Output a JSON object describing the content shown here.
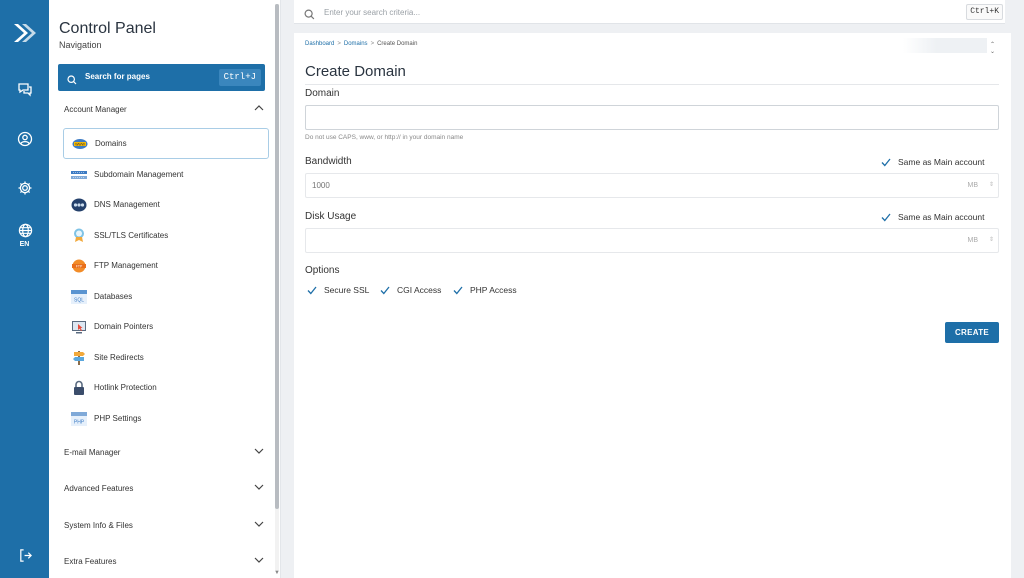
{
  "rail": {
    "language": "EN",
    "brand_color": "#1e6fa8"
  },
  "sidebar": {
    "title": "Control Panel",
    "subtitle": "Navigation",
    "search_label": "Search for pages",
    "search_shortcut": "Ctrl+J",
    "account_manager": {
      "label": "Account Manager",
      "items": [
        {
          "label": "Domains",
          "icon": "domains-icon",
          "active": true
        },
        {
          "label": "Subdomain Management",
          "icon": "subdomain-icon"
        },
        {
          "label": "DNS Management",
          "icon": "dns-icon"
        },
        {
          "label": "SSL/TLS Certificates",
          "icon": "ssl-certificate-icon"
        },
        {
          "label": "FTP Management",
          "icon": "ftp-icon"
        },
        {
          "label": "Databases",
          "icon": "sql-database-icon"
        },
        {
          "label": "Domain Pointers",
          "icon": "domain-pointer-icon"
        },
        {
          "label": "Site Redirects",
          "icon": "signpost-icon"
        },
        {
          "label": "Hotlink Protection",
          "icon": "padlock-icon"
        },
        {
          "label": "PHP Settings",
          "icon": "php-icon"
        }
      ]
    },
    "sections": [
      {
        "label": "E-mail Manager"
      },
      {
        "label": "Advanced Features"
      },
      {
        "label": "System Info & Files"
      },
      {
        "label": "Extra Features"
      }
    ]
  },
  "topbar": {
    "search_placeholder": "Enter your search criteria...",
    "search_shortcut": "Ctrl+K"
  },
  "breadcrumb": {
    "items": [
      "Dashboard",
      "Domains",
      "Create Domain"
    ]
  },
  "form": {
    "title": "Create Domain",
    "domain_label": "Domain",
    "domain_value": "",
    "domain_hint": "Do not use CAPS, www, or http:// in your domain name",
    "bandwidth_label": "Bandwidth",
    "bandwidth_placeholder": "1000",
    "bandwidth_unit": "MB",
    "bandwidth_same_label": "Same as Main account",
    "bandwidth_same_checked": true,
    "disk_label": "Disk Usage",
    "disk_placeholder": "",
    "disk_unit": "MB",
    "disk_same_label": "Same as Main account",
    "disk_same_checked": true,
    "options_label": "Options",
    "options": [
      {
        "label": "Secure SSL",
        "checked": true
      },
      {
        "label": "CGI Access",
        "checked": true
      },
      {
        "label": "PHP Access",
        "checked": true
      }
    ],
    "create_label": "CREATE"
  }
}
